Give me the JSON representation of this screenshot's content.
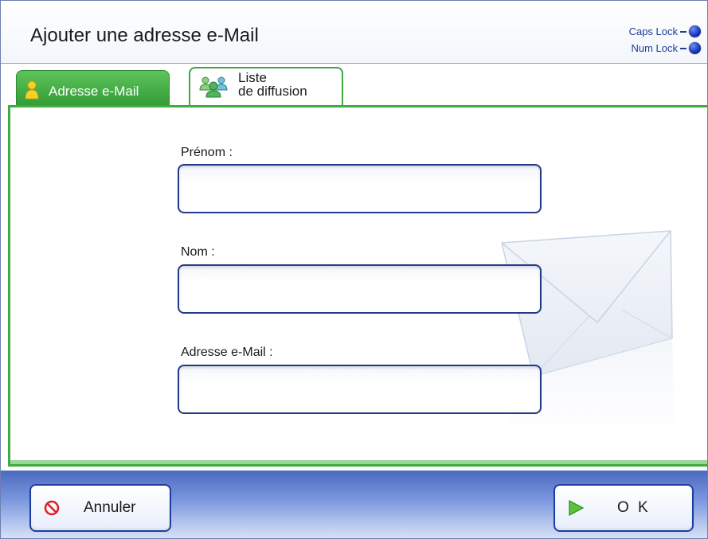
{
  "header": {
    "title": "Ajouter une adresse e-Mail",
    "caps_lock": "Caps Lock",
    "num_lock": "Num Lock"
  },
  "tabs": [
    {
      "label": "Adresse e-Mail",
      "icon": "person-icon",
      "active": true
    },
    {
      "label_line1": "Liste",
      "label_line2": "de diffusion",
      "icon": "group-icon",
      "active": false
    }
  ],
  "form": {
    "first_name_label": "Prénom :",
    "first_name_value": "",
    "last_name_label": "Nom :",
    "last_name_value": "",
    "email_label": "Adresse e-Mail :",
    "email_value": ""
  },
  "footer": {
    "cancel_label": "Annuler",
    "ok_label": "O K"
  },
  "colors": {
    "accent_green": "#3fac41",
    "button_border": "#1f3d9e",
    "footer_blue": "#4b69be"
  }
}
